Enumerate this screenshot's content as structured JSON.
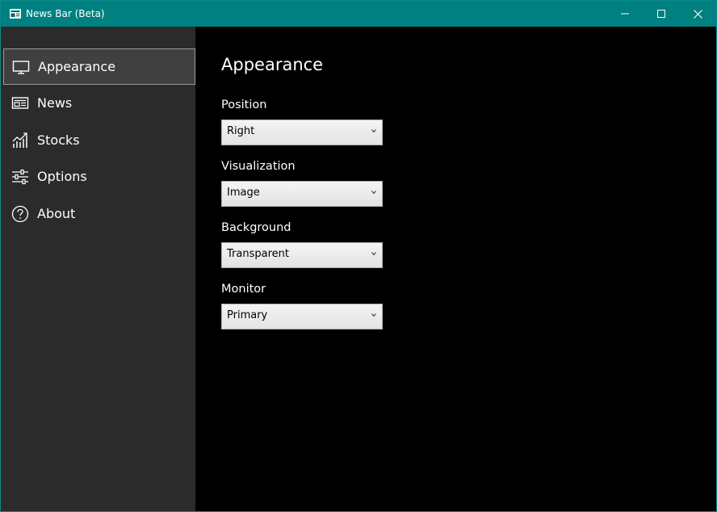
{
  "window": {
    "title": "News Bar (Beta)",
    "accent_color": "#008080"
  },
  "sidebar": {
    "background": "#2b2b2b",
    "items": [
      {
        "label": "Appearance",
        "icon": "monitor-icon",
        "active": true
      },
      {
        "label": "News",
        "icon": "newspaper-icon",
        "active": false
      },
      {
        "label": "Stocks",
        "icon": "stock-chart-icon",
        "active": false
      },
      {
        "label": "Options",
        "icon": "sliders-icon",
        "active": false
      },
      {
        "label": "About",
        "icon": "help-circle-icon",
        "active": false
      }
    ]
  },
  "main": {
    "title": "Appearance",
    "fields": [
      {
        "label": "Position",
        "value": "Right"
      },
      {
        "label": "Visualization",
        "value": "Image"
      },
      {
        "label": "Background",
        "value": "Transparent"
      },
      {
        "label": "Monitor",
        "value": "Primary"
      }
    ]
  }
}
